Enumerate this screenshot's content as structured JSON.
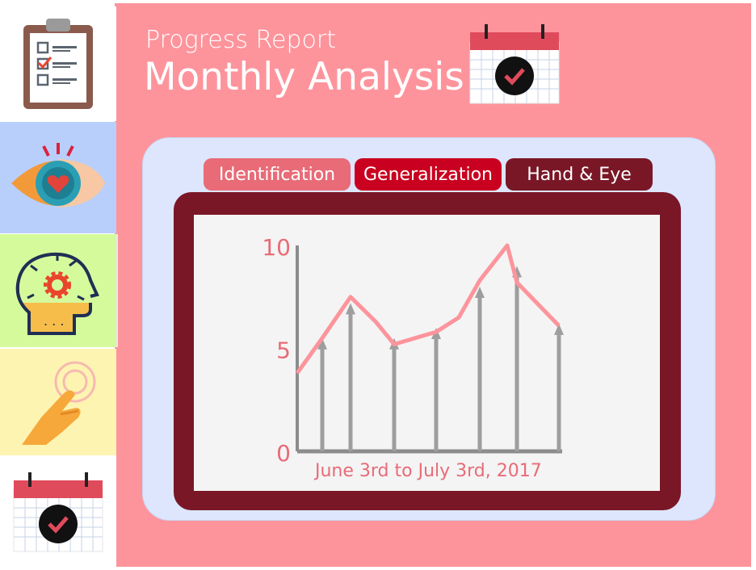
{
  "header": {
    "subtitle": "Progress Report",
    "title": "Monthly Analysis"
  },
  "sidebar": {
    "items": [
      {
        "icon": "clipboard-checklist-icon"
      },
      {
        "icon": "eye-heart-icon"
      },
      {
        "icon": "mind-gear-icon"
      },
      {
        "icon": "hand-touch-icon"
      },
      {
        "icon": "calendar-check-icon"
      }
    ]
  },
  "tabs": [
    {
      "label": "Identification",
      "color": "#e86b77"
    },
    {
      "label": "Generalization",
      "color": "#c9001f"
    },
    {
      "label": "Hand & Eye",
      "color": "#7a1727"
    }
  ],
  "colors": {
    "background": "#fd949c",
    "panel": "#dde6fd",
    "frame": "#7a1727",
    "line": "#fd949c",
    "arrow": "#9e9e9e"
  },
  "chart_data": {
    "type": "line",
    "xlabel": "June 3rd to July 3rd,  2017",
    "ylim": [
      0,
      10
    ],
    "yticks": [
      0,
      5,
      10
    ],
    "series": [
      {
        "type": "line",
        "values": [
          3.8,
          5.5,
          7.5,
          6.3,
          5.2,
          5.8,
          6.5,
          8.3,
          10.0,
          8.2,
          6.1
        ]
      },
      {
        "type": "arrows",
        "values": [
          5.5,
          7.2,
          5.5,
          6.0,
          8.0,
          9.0,
          6.2
        ]
      }
    ]
  }
}
